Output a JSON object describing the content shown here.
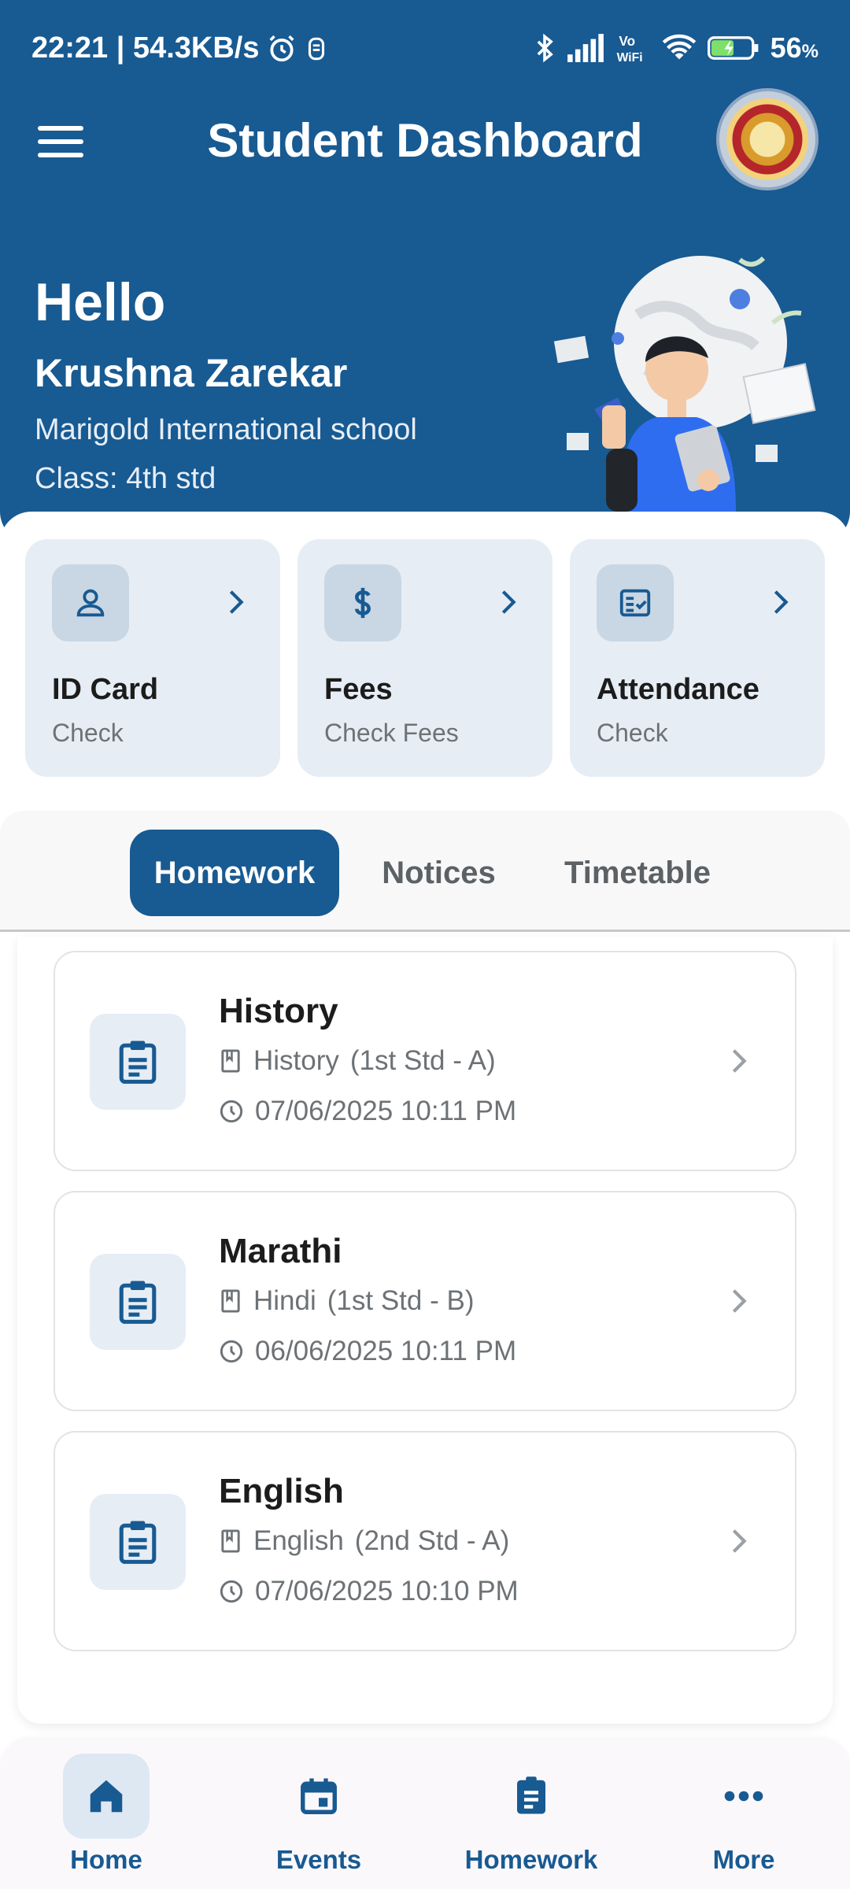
{
  "status_bar": {
    "time_speed": "22:21 | 54.3KB/s",
    "battery": "56",
    "battery_unit": "%",
    "icons": [
      "alarm-icon",
      "notification-icon",
      "bluetooth-icon",
      "signal-icon",
      "vowifi-icon",
      "wifi-icon",
      "battery-icon"
    ]
  },
  "app_bar": {
    "title": "Student Dashboard"
  },
  "greeting": {
    "hello": "Hello",
    "name": "Krushna Zarekar",
    "school": "Marigold International school",
    "class": "Class: 4th std"
  },
  "quick_actions": [
    {
      "title": "ID Card",
      "subtitle": "Check",
      "icon": "person-icon"
    },
    {
      "title": "Fees",
      "subtitle": "Check Fees",
      "icon": "dollar-icon"
    },
    {
      "title": "Attendance",
      "subtitle": "Check",
      "icon": "attendance-icon"
    }
  ],
  "tabs": [
    {
      "label": "Homework",
      "active": true
    },
    {
      "label": "Notices",
      "active": false
    },
    {
      "label": "Timetable",
      "active": false
    }
  ],
  "homework": [
    {
      "title": "History",
      "subject": "History",
      "class": "(1st Std - A)",
      "datetime": "07/06/2025 10:11 PM"
    },
    {
      "title": "Marathi",
      "subject": "Hindi",
      "class": "(1st Std - B)",
      "datetime": "06/06/2025 10:11 PM"
    },
    {
      "title": "English",
      "subject": "English",
      "class": "(2nd Std - A)",
      "datetime": "07/06/2025 10:10 PM"
    }
  ],
  "bottom_nav": [
    {
      "label": "Home",
      "icon": "home-icon",
      "active": true
    },
    {
      "label": "Events",
      "icon": "calendar-icon",
      "active": false
    },
    {
      "label": "Homework",
      "icon": "clipboard-icon",
      "active": false
    },
    {
      "label": "More",
      "icon": "more-icon",
      "active": false
    }
  ],
  "colors": {
    "primary": "#185a92",
    "card_bg": "#e6edf4",
    "muted_text": "#6d7276"
  }
}
